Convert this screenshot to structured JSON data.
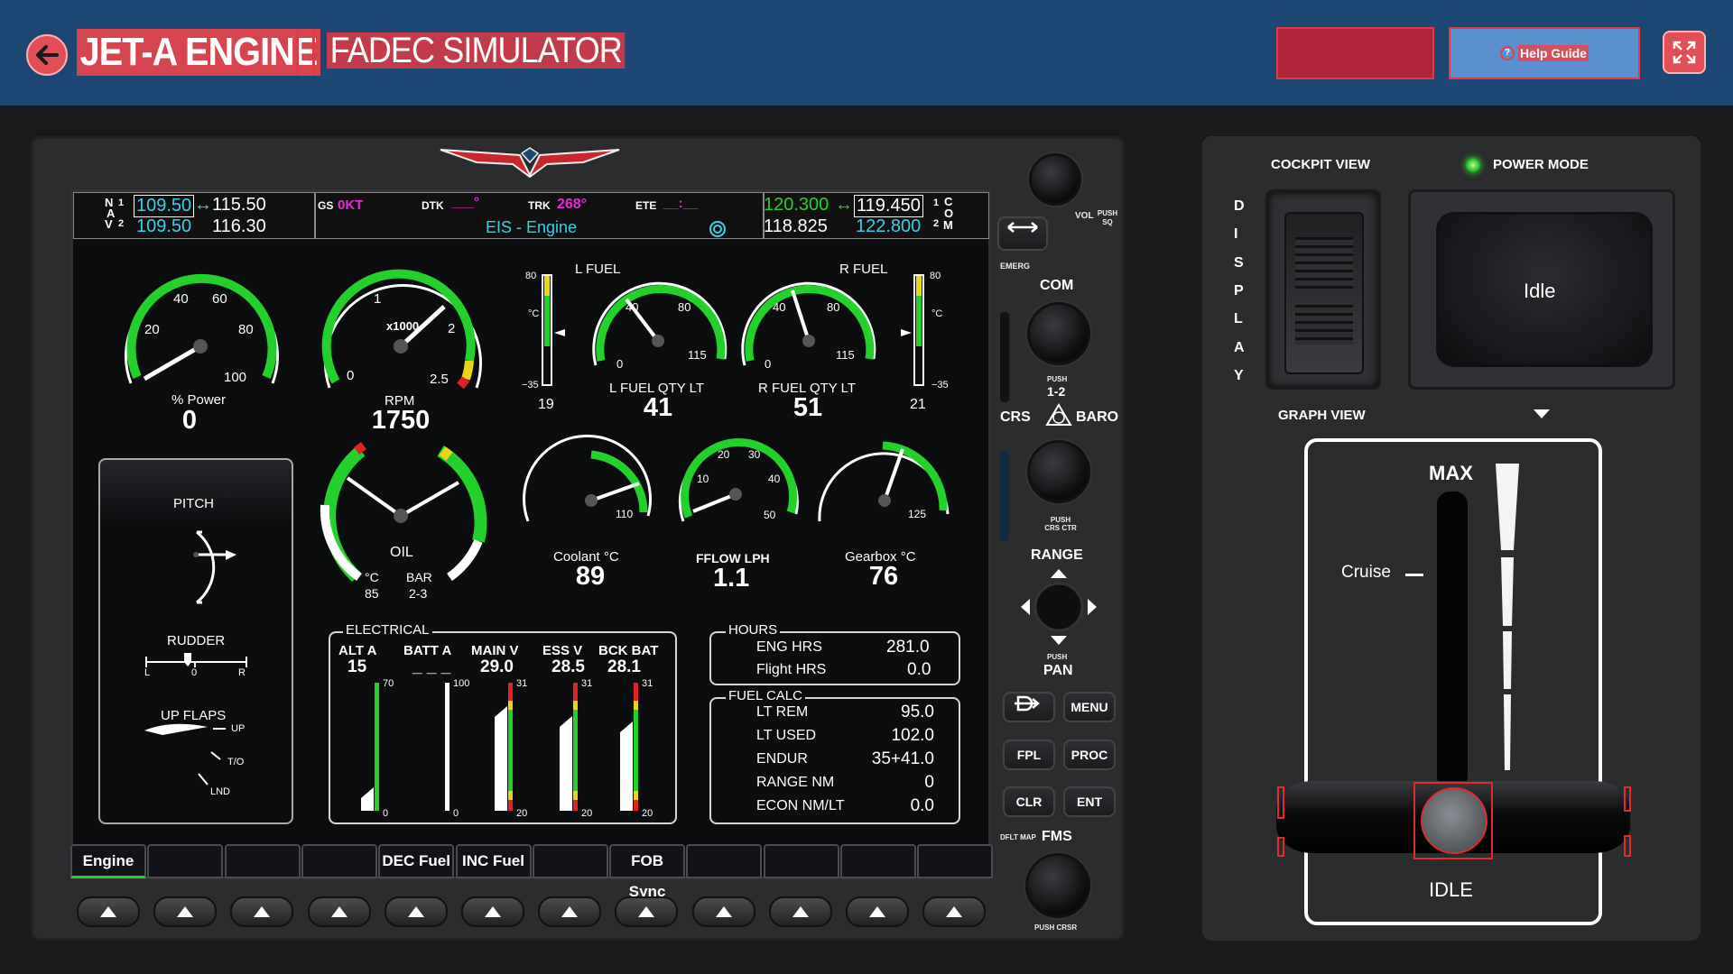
{
  "header": {
    "title": "JET-A ENGINE",
    "subtitle": "FADEC SIMULATOR",
    "help_label": "Help Guide",
    "back_icon": "arrow-left-icon",
    "expand_icon": "expand-icon"
  },
  "nav": {
    "n1": "N",
    "n2": "A",
    "n3": "V",
    "idx1": "1",
    "idx2": "2",
    "nav1_active": "109.50",
    "nav1_standby": "115.50",
    "nav2_active": "109.50",
    "nav2_standby": "116.30",
    "arrow": "↔"
  },
  "status": {
    "gs_label": "GS",
    "gs_value": "0KT",
    "dtk_label": "DTK",
    "dtk_value": "___°",
    "trk_label": "TRK",
    "trk_value": "268°",
    "ete_label": "ETE",
    "ete_value": "__:__",
    "page": "EIS - Engine"
  },
  "com": {
    "com1_active": "120.300",
    "com1_standby": "119.450",
    "com2_active": "118.825",
    "com2_standby": "122.800",
    "arrow": "↔",
    "l1": "C",
    "l2": "O",
    "l3": "M",
    "idx1": "1",
    "idx2": "2"
  },
  "gauges": {
    "power": {
      "label": "% Power",
      "value": "0",
      "ticks": [
        "20",
        "40",
        "60",
        "80",
        "100"
      ]
    },
    "rpm": {
      "label": "RPM",
      "value": "1750",
      "ticks": [
        "0",
        "1",
        "x1000",
        "2",
        "2.5"
      ]
    },
    "oil": {
      "label": "OIL",
      "temp_unit": "°C",
      "temp": "85",
      "pres_unit": "BAR",
      "pres": "2-3"
    },
    "lfuel": {
      "label": "L FUEL",
      "qty_label": "L FUEL QTY LT",
      "qty": "41",
      "ticks": [
        "40",
        "80",
        "115",
        "0"
      ],
      "temp_top": "80",
      "temp_unit": "°C",
      "temp_bot": "−35",
      "temp_val": "19"
    },
    "rfuel": {
      "label": "R FUEL",
      "qty_label": "R FUEL QTY LT",
      "qty": "51",
      "ticks": [
        "40",
        "80",
        "115",
        "0"
      ],
      "temp_top": "80",
      "temp_unit": "°C",
      "temp_bot": "−35",
      "temp_val": "21"
    },
    "coolant": {
      "label": "Coolant °C",
      "value": "89",
      "tick": "110"
    },
    "fflow": {
      "label": "FFLOW LPH",
      "value": "1.1",
      "ticks": [
        "10",
        "20",
        "30",
        "40",
        "50"
      ]
    },
    "gearbox": {
      "label": "Gearbox °C",
      "value": "76",
      "tick": "125"
    }
  },
  "trim": {
    "pitch": "PITCH",
    "rudder": "RUDDER",
    "r_l": "L",
    "r_0": "0",
    "r_r": "R",
    "flaps": "UP FLAPS",
    "up": "UP",
    "to": "T/O",
    "lnd": "LND"
  },
  "electrical": {
    "title": "ELECTRICAL",
    "cols": [
      {
        "name": "ALT A",
        "value": "15",
        "top": "70",
        "bot": "0"
      },
      {
        "name": "BATT A",
        "value": "_ _ _",
        "top": "100",
        "bot": "0"
      },
      {
        "name": "MAIN V",
        "value": "29.0",
        "top": "31",
        "bot": "20"
      },
      {
        "name": "ESS V",
        "value": "28.5",
        "top": "31",
        "bot": "20"
      },
      {
        "name": "BCK BAT",
        "value": "28.1",
        "top": "31",
        "bot": "20"
      }
    ]
  },
  "hours": {
    "title": "HOURS",
    "eng_label": "ENG HRS",
    "eng": "281.0",
    "flight_label": "Flight HRS",
    "flight": "0.0"
  },
  "fuelcalc": {
    "title": "FUEL CALC",
    "rows": [
      {
        "label": "LT REM",
        "value": "95.0"
      },
      {
        "label": "LT USED",
        "value": "102.0"
      },
      {
        "label": "ENDUR",
        "value": "35+41.0"
      },
      {
        "label": "RANGE NM",
        "value": "0"
      },
      {
        "label": "ECON NM/LT",
        "value": "0.0"
      }
    ]
  },
  "softkeys": [
    "Engine",
    "",
    "",
    "",
    "DEC Fuel",
    "INC Fuel",
    "",
    "FOB Sync",
    "",
    "",
    "",
    ""
  ],
  "bezel": {
    "vol": "VOL",
    "push_sq": "PUSH SQ",
    "emerg": "EMERG",
    "com": "COM",
    "push12": "PUSH",
    "com12": "1-2",
    "crs": "CRS",
    "baro": "BARO",
    "push_crs": "PUSH CRS CTR",
    "range": "RANGE",
    "push_pan": "PUSH",
    "pan": "PAN",
    "menu": "MENU",
    "fpl": "FPL",
    "proc": "PROC",
    "clr": "CLR",
    "ent": "ENT",
    "dflt": "DFLT MAP",
    "fms": "FMS",
    "push_crsr": "PUSH CRSR"
  },
  "right": {
    "cockpit_view": "COCKPIT VIEW",
    "power_mode": "POWER MODE",
    "display_letters": [
      "D",
      "I",
      "S",
      "P",
      "L",
      "A",
      "Y"
    ],
    "mode": "Idle",
    "graph_view": "GRAPH VIEW",
    "max": "MAX",
    "cruise": "Cruise",
    "idle": "IDLE"
  },
  "colors": {
    "header": "#1d4773",
    "accent_red": "#e03a44",
    "cyan": "#3ad0e8",
    "magenta": "#e62ad6",
    "green": "#22d12a"
  }
}
